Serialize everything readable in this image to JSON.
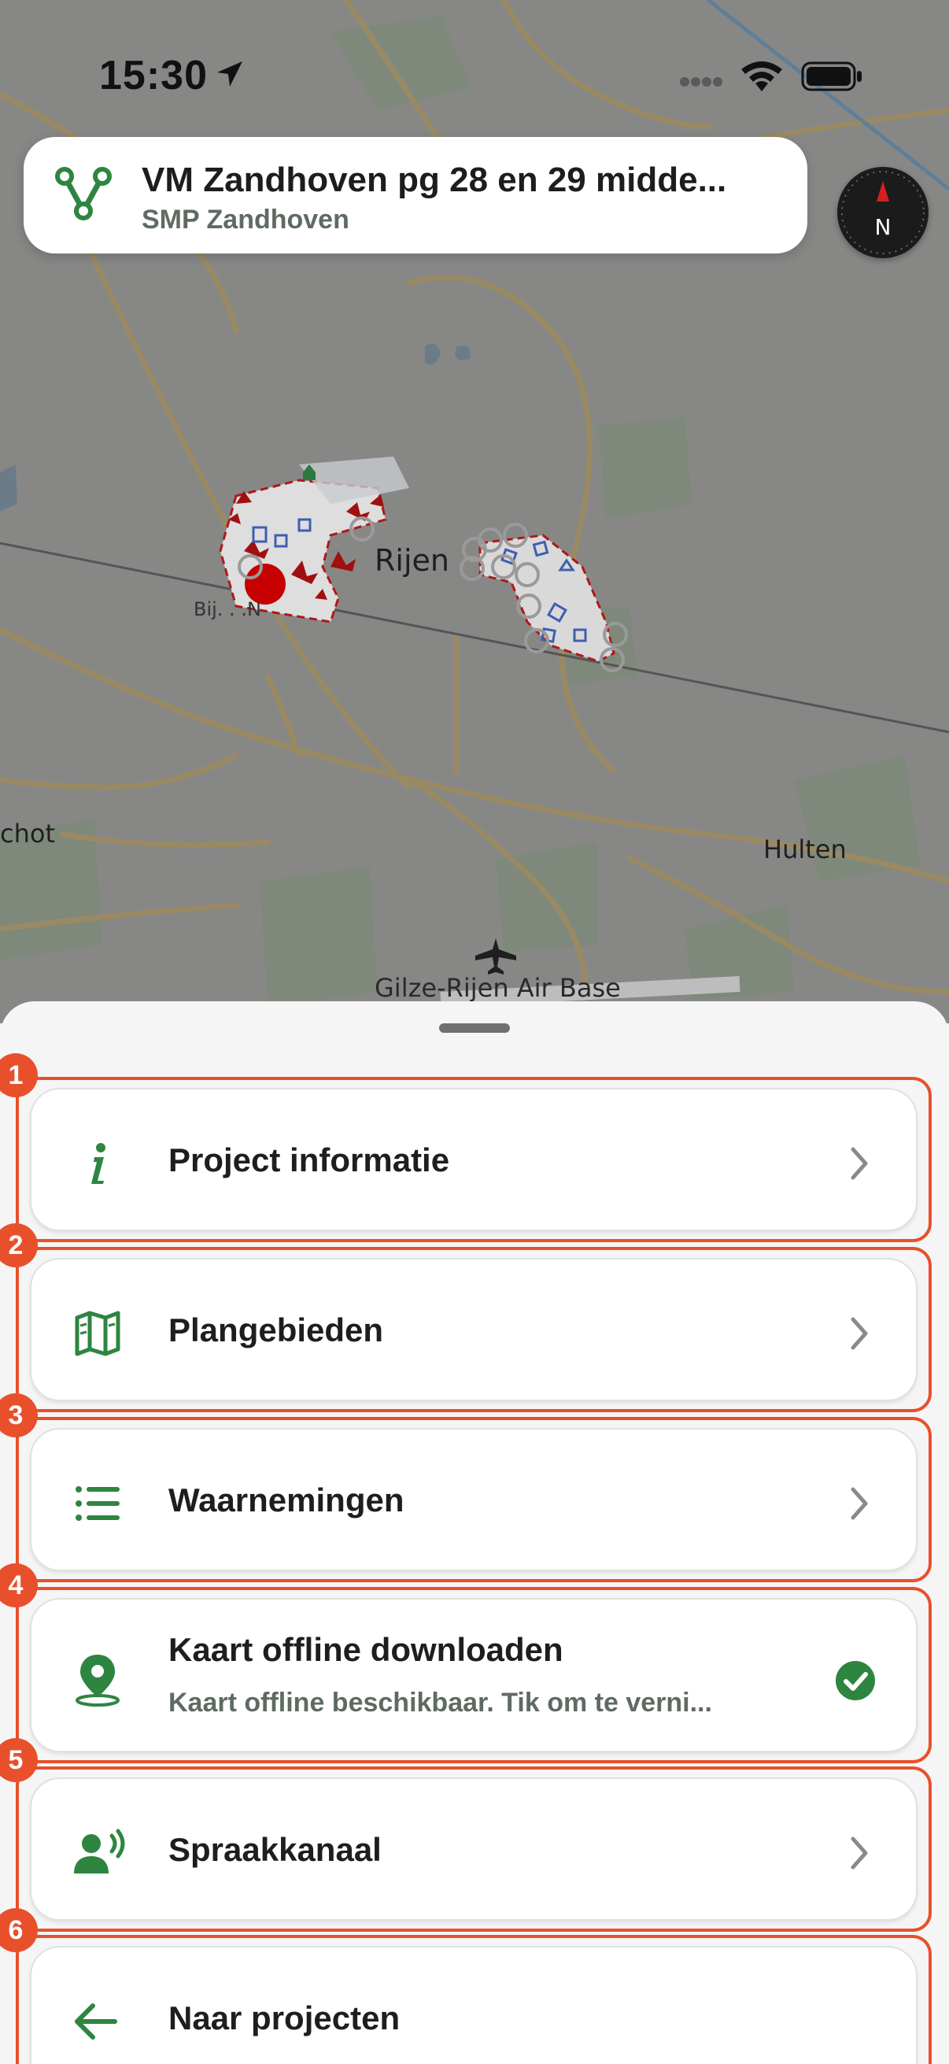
{
  "status_bar": {
    "time": "15:30"
  },
  "project": {
    "title": "VM Zandhoven pg 28 en 29 midde...",
    "subtitle": "SMP Zandhoven"
  },
  "compass": {
    "label": "N"
  },
  "map": {
    "labels": {
      "rijen": "Rijen",
      "hulten": "Hulten",
      "chot": "chot",
      "airbase": "Gilze-Rijen Air Base",
      "partial": "Вij. . .N"
    }
  },
  "menu": [
    {
      "number": "1",
      "label": "Project informatie",
      "icon": "info-icon"
    },
    {
      "number": "2",
      "label": "Plangebieden",
      "icon": "map-icon"
    },
    {
      "number": "3",
      "label": "Waarnemingen",
      "icon": "list-icon"
    },
    {
      "number": "4",
      "label": "Kaart offline downloaden",
      "sub": "Kaart offline beschikbaar. Tik om te verni...",
      "icon": "location-pin-icon",
      "status_icon": "check-circle-icon"
    },
    {
      "number": "5",
      "label": "Spraakkanaal",
      "icon": "voice-user-icon"
    },
    {
      "number": "6",
      "label": "Naar projecten",
      "icon": "arrow-left-icon"
    }
  ],
  "colors": {
    "accent_green": "#2e8540",
    "annotation_orange": "#e8502c",
    "map_background": "#878886"
  }
}
